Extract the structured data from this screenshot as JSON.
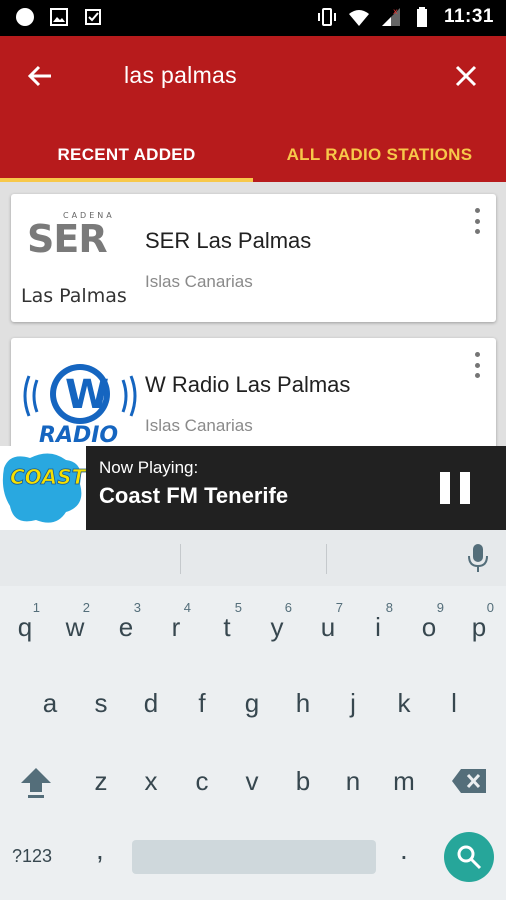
{
  "status_bar": {
    "time": "11:31",
    "icons": [
      "circle-notification-icon",
      "image-icon",
      "checkmark-task-icon",
      "vibrate-icon",
      "wifi-icon",
      "signal-icon",
      "battery-icon"
    ]
  },
  "app_bar": {
    "search_query": "las palmas",
    "back_icon": "arrow-left-icon",
    "close_icon": "close-icon",
    "background": "#b71b1c",
    "accent": "#f7c84a"
  },
  "tabs": [
    {
      "label": "RECENT ADDED",
      "active": true
    },
    {
      "label": "ALL RADIO STATIONS",
      "active": false
    }
  ],
  "stations": [
    {
      "name": "SER Las Palmas",
      "region": "Islas Canarias",
      "logo_top": "CADENA",
      "logo_brand": "SER",
      "logo_city": "Las Palmas"
    },
    {
      "name": "W Radio Las Palmas",
      "region": "Islas Canarias",
      "logo_brand": "W",
      "logo_word": "RADIO"
    }
  ],
  "now_playing": {
    "label": "Now Playing:",
    "title": "Coast FM Tenerife",
    "logo_text": "COAST FM",
    "control": "pause-icon"
  },
  "keyboard": {
    "row1": [
      {
        "key": "q",
        "hint": "1"
      },
      {
        "key": "w",
        "hint": "2"
      },
      {
        "key": "e",
        "hint": "3"
      },
      {
        "key": "r",
        "hint": "4"
      },
      {
        "key": "t",
        "hint": "5"
      },
      {
        "key": "y",
        "hint": "6"
      },
      {
        "key": "u",
        "hint": "7"
      },
      {
        "key": "i",
        "hint": "8"
      },
      {
        "key": "o",
        "hint": "9"
      },
      {
        "key": "p",
        "hint": "0"
      }
    ],
    "row2": [
      "a",
      "s",
      "d",
      "f",
      "g",
      "h",
      "j",
      "k",
      "l"
    ],
    "row3": [
      "z",
      "x",
      "c",
      "v",
      "b",
      "n",
      "m"
    ],
    "symbols_key": "?123",
    "comma": ",",
    "period": ".",
    "search_color": "#26a69a"
  }
}
